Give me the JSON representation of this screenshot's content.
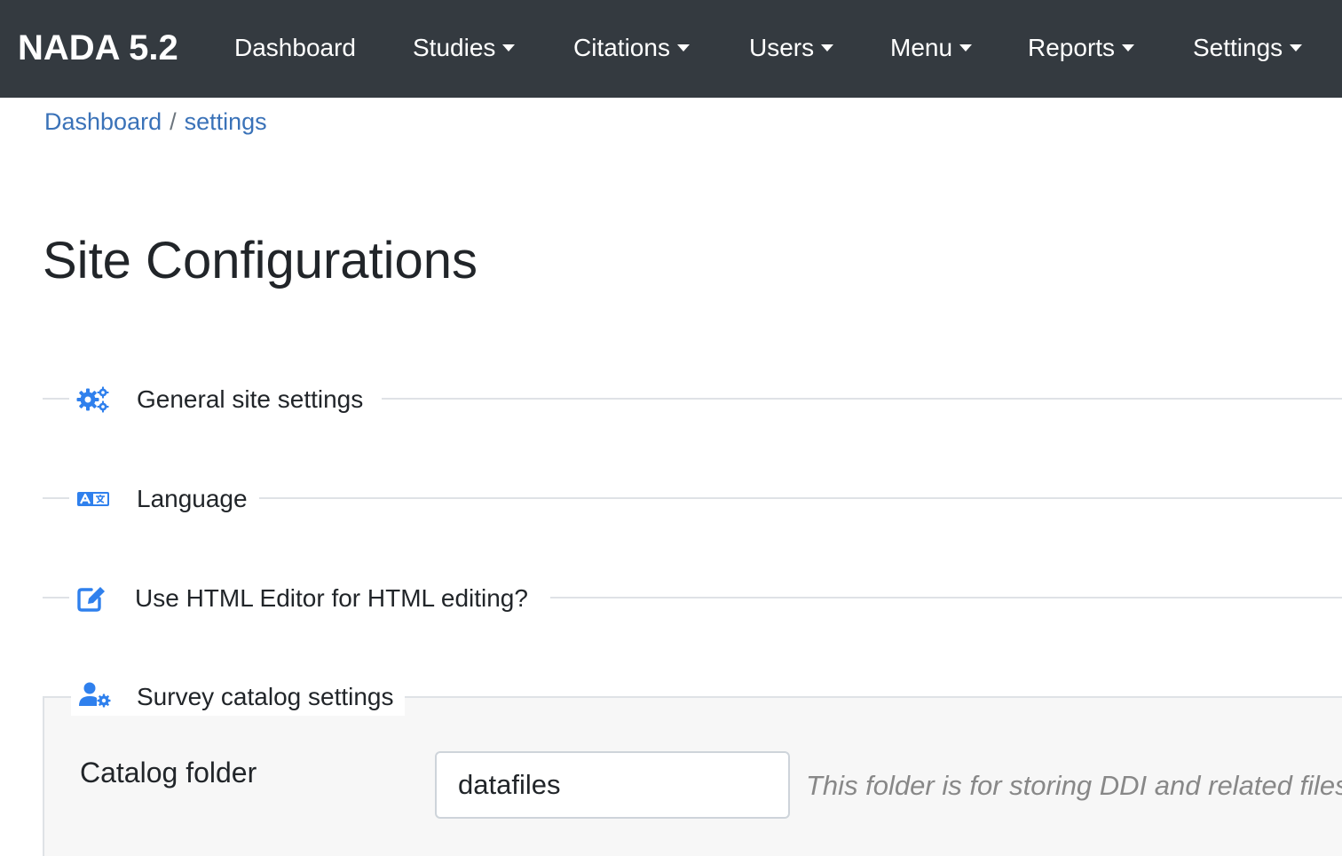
{
  "navbar": {
    "brand": "NADA 5.2",
    "items": [
      {
        "label": "Dashboard",
        "dropdown": false
      },
      {
        "label": "Studies",
        "dropdown": true
      },
      {
        "label": "Citations",
        "dropdown": true
      },
      {
        "label": "Users",
        "dropdown": true
      },
      {
        "label": "Menu",
        "dropdown": true
      },
      {
        "label": "Reports",
        "dropdown": true
      },
      {
        "label": "Settings",
        "dropdown": true
      }
    ]
  },
  "breadcrumb": {
    "items": [
      "Dashboard",
      "settings"
    ],
    "separator": "/"
  },
  "page": {
    "title": "Site Configurations"
  },
  "sections": [
    {
      "label": "General site settings",
      "icon": "cogs-icon"
    },
    {
      "label": "Language",
      "icon": "language-icon"
    },
    {
      "label": "Use HTML Editor for HTML editing?",
      "icon": "edit-icon"
    },
    {
      "label": "Survey catalog settings",
      "icon": "user-cog-icon"
    }
  ],
  "catalog_settings": {
    "folder_label": "Catalog folder",
    "folder_value": "datafiles",
    "folder_help": "This folder is for storing DDI and related files"
  },
  "colors": {
    "navbar_bg": "#343a40",
    "link": "#3a72b8",
    "icon_blue": "#2f80ed",
    "fieldset_bg": "#f7f7f7"
  }
}
